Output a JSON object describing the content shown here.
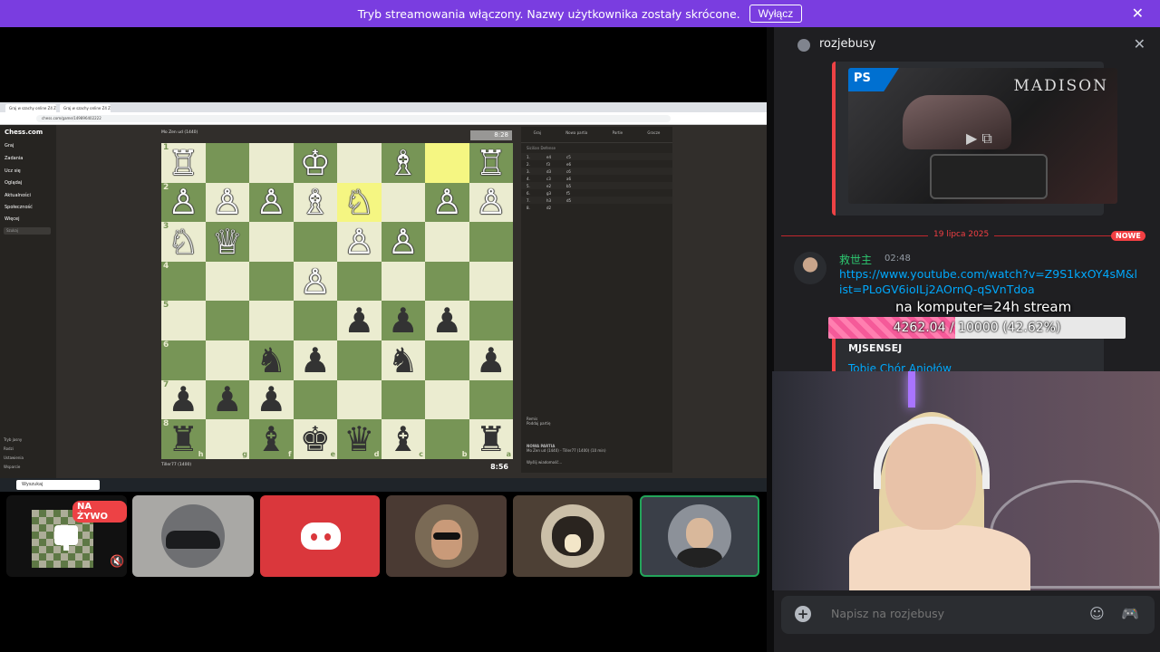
{
  "banner": {
    "message": "Tryb streamowania włączony. Nazwy użytkownika zostały skrócone.",
    "button": "Wyłącz",
    "close": "✕"
  },
  "stream": {
    "browser_tabs": [
      "Graj w szachy online Z4 Zadko...",
      "Graj w szachy online Z4 Zadko..."
    ],
    "url": "chess.com/game/149896402222",
    "chess_logo": "Chess.com",
    "nav": [
      "Graj",
      "Zadania",
      "Ucz się",
      "Oglądaj",
      "Aktualności",
      "Społeczność",
      "Więcej"
    ],
    "search_placeholder": "Szukaj",
    "footer_links": [
      "Tryb jasny",
      "Rodzi",
      "Ustawienia",
      "Wsparcie"
    ],
    "top_player": "Mo Zen ud (1440)",
    "bottom_player": "Tiller77 (1400)",
    "top_clock": "8:28",
    "bottom_clock": "8:56",
    "panel_tabs": [
      "Graj",
      "Nowa partia",
      "Partie",
      "Gracze"
    ],
    "panel_heading": "Sicilian Defense",
    "moves": [
      [
        "1.",
        "e4",
        "c5"
      ],
      [
        "2.",
        "f3",
        "e6"
      ],
      [
        "3.",
        "d3",
        "c6"
      ],
      [
        "4.",
        "c3",
        "a6"
      ],
      [
        "5.",
        "e2",
        "b5"
      ],
      [
        "6.",
        "g3",
        "f5"
      ],
      [
        "7.",
        "h3",
        "d5"
      ],
      [
        "8.",
        "d2",
        ""
      ]
    ],
    "panel_buttons": [
      "Remis",
      "Poddaj partię"
    ],
    "panel_footer_title": "NOWA PARTIA",
    "panel_footer_line": "Mo Zen ud (1440) - Tiller77 (1400) (10 min)",
    "panel_input": "Wyślij wiadomość...",
    "taskbar_search": "Wyszukaj",
    "ranks": [
      "1",
      "2",
      "3",
      "4",
      "5",
      "6",
      "7",
      "8"
    ],
    "files": [
      "h",
      "g",
      "f",
      "e",
      "d",
      "c",
      "b",
      "a"
    ],
    "board": [
      [
        "wR",
        "",
        "",
        "wK",
        "",
        "wB",
        "",
        "wR"
      ],
      [
        "wP",
        "wP",
        "wP",
        "wB",
        "wN",
        "",
        "wP",
        "wP"
      ],
      [
        "wN",
        "wQ",
        "",
        "",
        "wP",
        "wP",
        "",
        ""
      ],
      [
        "",
        "",
        "",
        "wP",
        "",
        "",
        "",
        ""
      ],
      [
        "",
        "",
        "",
        "",
        "bP",
        "bP",
        "bP",
        ""
      ],
      [
        "",
        "",
        "bN",
        "bP",
        "",
        "bN",
        "",
        "bP"
      ],
      [
        "bP",
        "bP",
        "bP",
        "",
        "",
        "",
        "",
        ""
      ],
      [
        "bR",
        "",
        "bB",
        "bK",
        "bQ",
        "bB",
        "",
        "bR"
      ]
    ]
  },
  "tiles": {
    "live_badge": "NA ŻYWO"
  },
  "chat": {
    "title": "rozjebusy",
    "embed_brand": "MADISON",
    "date_divider": "19 lipca 2025",
    "new_badge": "NOWE",
    "author": "救世主",
    "time": "02:48",
    "link": "https://www.youtube.com/watch?v=Z9S1kxOY4sM&list=PLoGV6ioILj2AOrnQ-qSVnTdoa",
    "overlay_title": "na komputer=24h stream",
    "progress_text": "4262.04 / 10000 (42.62%)",
    "progress_fraction": 0.4262,
    "embed2_author": "MJSENSEJ",
    "embed2_title": "Tobie Chór Aniołów",
    "composer_placeholder": "Napisz na rozjebusy"
  }
}
